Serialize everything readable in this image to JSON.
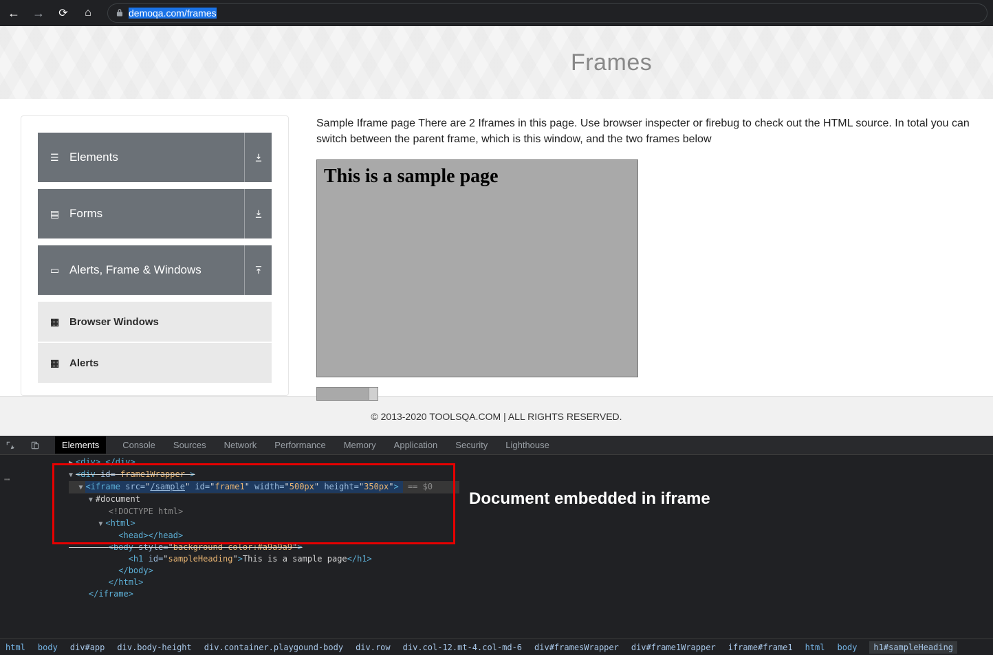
{
  "browser": {
    "url_host": "demoqa.com",
    "url_path": "/frames"
  },
  "page": {
    "title": "Frames",
    "intro": "Sample Iframe page There are 2 Iframes in this page. Use browser inspecter or firebug to check out the HTML source. In total you can switch between the parent frame, which is this window, and the two frames below",
    "iframe_heading": "This is a sample page",
    "footer": "© 2013-2020 TOOLSQA.COM | ALL RIGHTS RESERVED."
  },
  "sidebar": {
    "items": [
      {
        "label": "Elements",
        "expanded": false
      },
      {
        "label": "Forms",
        "expanded": false
      },
      {
        "label": "Alerts, Frame & Windows",
        "expanded": true
      }
    ],
    "sub": [
      {
        "label": "Browser Windows"
      },
      {
        "label": "Alerts"
      }
    ]
  },
  "devtools": {
    "tabs": [
      "Elements",
      "Console",
      "Sources",
      "Network",
      "Performance",
      "Memory",
      "Application",
      "Security",
      "Lighthouse"
    ],
    "annotation": "Document embedded in iframe",
    "dom_lines": {
      "l0": "<div>…</div>",
      "l1_open": "<div",
      "l1_id_attr": " id=",
      "l1_id_val": " frame1Wrapper ",
      "l1_close": ">",
      "iframe_open": "<iframe",
      "iframe_src_attr": " src=",
      "iframe_src_val": "/sample",
      "iframe_id_attr": " id=",
      "iframe_id_val": "frame1",
      "iframe_w_attr": " width=",
      "iframe_w_val": "500px",
      "iframe_h_attr": " height=",
      "iframe_h_val": "350px",
      "iframe_end": ">",
      "iframe_comment": " == $0",
      "doc": "#document",
      "doctype": "<!DOCTYPE html>",
      "html_open": "<html>",
      "head": "<head></head>",
      "body_open": "<body",
      "body_style_attr": " style=",
      "body_style_val": "background-color:#a9a9a9",
      "h1_open": "<h1",
      "h1_id_attr": " id=",
      "h1_id_val": "sampleHeading",
      "h1_text": "This is a sample page",
      "h1_close": "</h1>",
      "body_close": "</body>",
      "html_close": "</html>",
      "iframe_close": "</iframe>"
    },
    "breadcrumb": [
      "html",
      "body",
      "div#app",
      "div.body-height",
      "div.container.playgound-body",
      "div.row",
      "div.col-12.mt-4.col-md-6",
      "div#framesWrapper",
      "div#frame1Wrapper",
      "iframe#frame1",
      "html",
      "body",
      "h1#sampleHeading"
    ]
  }
}
